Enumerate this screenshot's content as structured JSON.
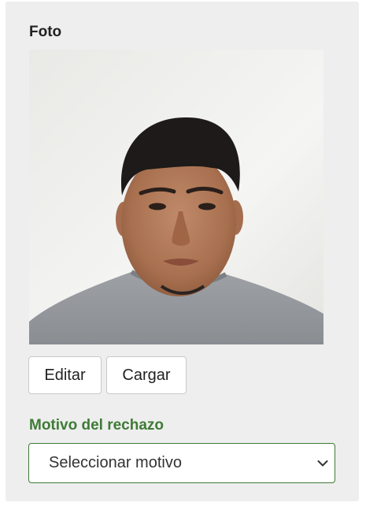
{
  "photo": {
    "label": "Foto"
  },
  "actions": {
    "edit_label": "Editar",
    "upload_label": "Cargar"
  },
  "rejection": {
    "label": "Motivo del rechazo",
    "selected": "Seleccionar motivo"
  },
  "icons": {
    "dropdown": "chevron-down-icon"
  },
  "colors": {
    "panel_bg": "#eeeeee",
    "accent_green": "#3e7b35",
    "text": "#222222"
  }
}
